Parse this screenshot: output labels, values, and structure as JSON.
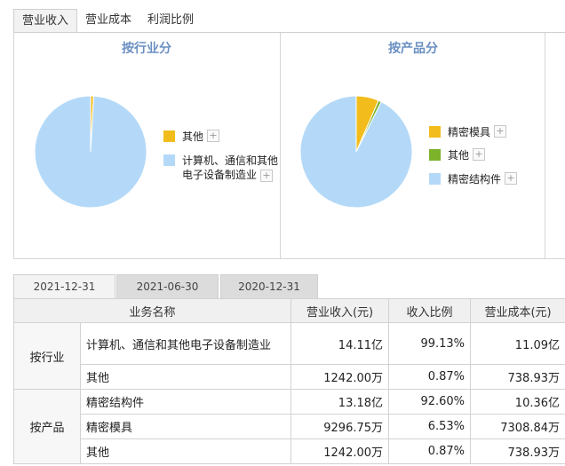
{
  "top_tabs": [
    {
      "label": "营业收入",
      "active": true
    },
    {
      "label": "营业成本",
      "active": false
    },
    {
      "label": "利润比例",
      "active": false
    }
  ],
  "charts": [
    {
      "title": "按行业分",
      "legend": [
        {
          "label": "其他",
          "color": "#f2bd1c"
        },
        {
          "label": "计算机、通信和其他电子设备制造业",
          "color": "#b4d9f8"
        }
      ]
    },
    {
      "title": "按产品分",
      "legend": [
        {
          "label": "精密模具",
          "color": "#f2bd1c"
        },
        {
          "label": "其他",
          "color": "#7cb32b"
        },
        {
          "label": "精密结构件",
          "color": "#b4d9f8"
        }
      ]
    }
  ],
  "chart_data": [
    {
      "type": "pie",
      "title": "按行业分",
      "categories": [
        "其他",
        "计算机、通信和其他电子设备制造业"
      ],
      "values": [
        0.87,
        99.13
      ],
      "colors": [
        "#f2bd1c",
        "#b4d9f8"
      ],
      "legend": "right"
    },
    {
      "type": "pie",
      "title": "按产品分",
      "categories": [
        "精密模具",
        "其他",
        "精密结构件"
      ],
      "values": [
        6.53,
        0.87,
        92.6
      ],
      "colors": [
        "#f2bd1c",
        "#7cb32b",
        "#b4d9f8"
      ],
      "legend": "right"
    }
  ],
  "date_tabs": [
    {
      "label": "2021-12-31",
      "active": true
    },
    {
      "label": "2021-06-30",
      "active": false
    },
    {
      "label": "2020-12-31",
      "active": false
    }
  ],
  "table": {
    "headers": [
      "业务名称",
      "营业收入(元)",
      "收入比例",
      "营业成本(元)"
    ],
    "groups": [
      {
        "name": "按行业",
        "rows": [
          {
            "name": "计算机、通信和其他电子设备制造业",
            "revenue": "14.11亿",
            "ratio": "99.13%",
            "cost": "11.09亿"
          },
          {
            "name": "其他",
            "revenue": "1242.00万",
            "ratio": "0.87%",
            "cost": "738.93万"
          }
        ]
      },
      {
        "name": "按产品",
        "rows": [
          {
            "name": "精密结构件",
            "revenue": "13.18亿",
            "ratio": "92.60%",
            "cost": "10.36亿"
          },
          {
            "name": "精密模具",
            "revenue": "9296.75万",
            "ratio": "6.53%",
            "cost": "7308.84万"
          },
          {
            "name": "其他",
            "revenue": "1242.00万",
            "ratio": "0.87%",
            "cost": "738.93万"
          }
        ]
      }
    ]
  }
}
